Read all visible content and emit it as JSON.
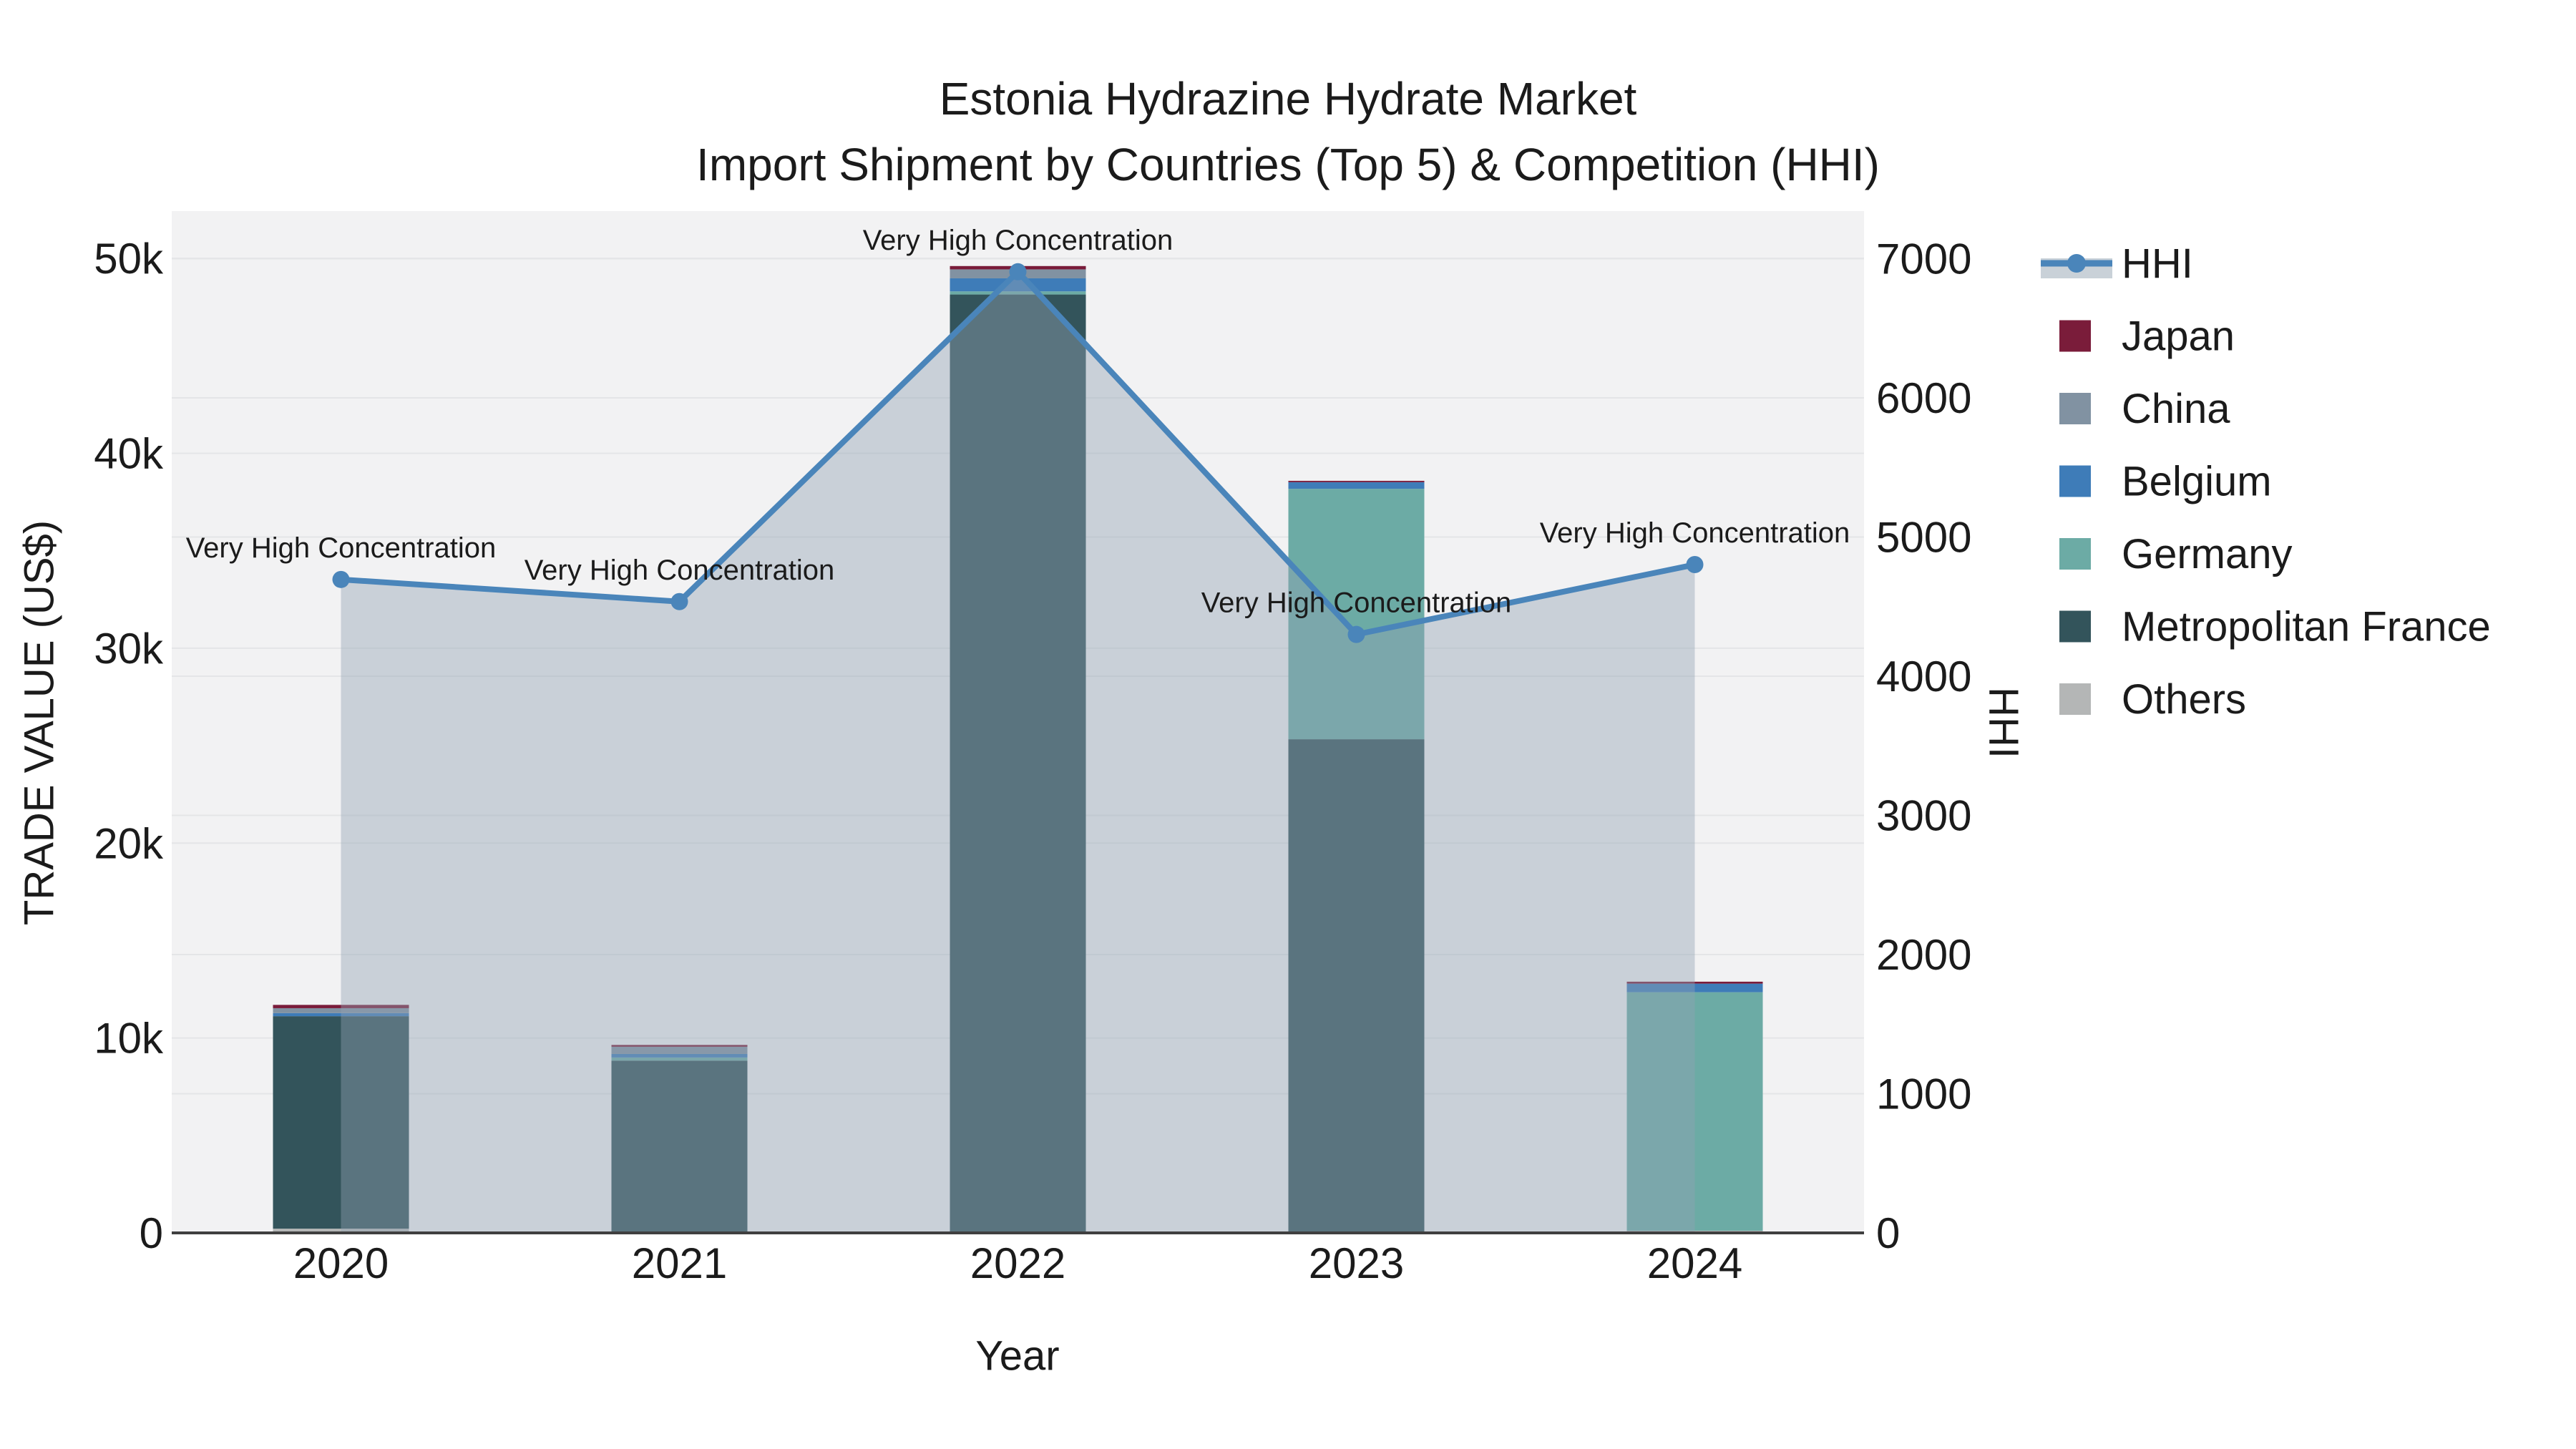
{
  "title": {
    "line1": "Estonia Hydrazine Hydrate Market",
    "line2": "Import Shipment by Countries (Top 5) & Competition (HHI)"
  },
  "axes": {
    "left": {
      "title": "TRADE VALUE (US$)",
      "ticks": [
        {
          "label": "0",
          "value": 0
        },
        {
          "label": "10k",
          "value": 10000
        },
        {
          "label": "20k",
          "value": 20000
        },
        {
          "label": "30k",
          "value": 30000
        },
        {
          "label": "40k",
          "value": 40000
        },
        {
          "label": "50k",
          "value": 50000
        }
      ]
    },
    "right": {
      "title": "HHI",
      "ticks": [
        {
          "label": "0",
          "value": 0
        },
        {
          "label": "1000",
          "value": 1000
        },
        {
          "label": "2000",
          "value": 2000
        },
        {
          "label": "3000",
          "value": 3000
        },
        {
          "label": "4000",
          "value": 4000
        },
        {
          "label": "5000",
          "value": 5000
        },
        {
          "label": "6000",
          "value": 6000
        },
        {
          "label": "7000",
          "value": 7000
        }
      ]
    },
    "x": {
      "title": "Year",
      "categories": [
        "2020",
        "2021",
        "2022",
        "2023",
        "2024"
      ]
    }
  },
  "chart_data": {
    "type": "bar+line",
    "title": "Estonia Hydrazine Hydrate Market — Import Shipment by Countries (Top 5) & Competition (HHI)",
    "categories": [
      2020,
      2021,
      2022,
      2023,
      2024
    ],
    "stack_series": [
      {
        "name": "Others",
        "color": "#b4b6b6",
        "values": [
          220,
          60,
          0,
          0,
          110
        ]
      },
      {
        "name": "Metropolitan France",
        "color": "#33545b",
        "values": [
          10900,
          8780,
          48150,
          25330,
          0
        ]
      },
      {
        "name": "Germany",
        "color": "#6caba5",
        "values": [
          0,
          160,
          160,
          12850,
          12240
        ]
      },
      {
        "name": "Belgium",
        "color": "#3e7cb8",
        "values": [
          160,
          180,
          670,
          340,
          440
        ]
      },
      {
        "name": "China",
        "color": "#8192a2",
        "values": [
          250,
          370,
          460,
          0,
          0
        ]
      },
      {
        "name": "Japan",
        "color": "#7a1c3a",
        "values": [
          170,
          95,
          170,
          70,
          100
        ]
      }
    ],
    "line_series": {
      "name": "HHI",
      "axis": "right",
      "color": "#4a85ba",
      "values": [
        4695,
        4536,
        6906,
        4300,
        4802
      ]
    },
    "ylim_left": [
      0,
      52430
    ],
    "ylim_right": [
      0,
      7342
    ],
    "xlabel": "Year",
    "ylabel_left": "TRADE VALUE (US$)",
    "ylabel_right": "HHI",
    "grid": true,
    "legend_position": "right"
  },
  "annotations": [
    {
      "year": 2020,
      "text": "Very High Concentration"
    },
    {
      "year": 2021,
      "text": "Very High Concentration"
    },
    {
      "year": 2022,
      "text": "Very High Concentration"
    },
    {
      "year": 2023,
      "text": "Very High Concentration"
    },
    {
      "year": 2024,
      "text": "Very High Concentration"
    }
  ],
  "legend": {
    "items": [
      {
        "label": "HHI",
        "type": "line"
      },
      {
        "label": "Japan",
        "type": "bar"
      },
      {
        "label": "China",
        "type": "bar"
      },
      {
        "label": "Belgium",
        "type": "bar"
      },
      {
        "label": "Germany",
        "type": "bar"
      },
      {
        "label": "Metropolitan France",
        "type": "bar"
      },
      {
        "label": "Others",
        "type": "bar"
      }
    ]
  },
  "colors": {
    "hhi_line": "#4a85ba",
    "hhi_area": "rgba(145,161,179,0.42)",
    "hhi_area_swatch": "#c9d1d8",
    "plot_bg": "#f2f2f3",
    "grid": "#e4e5e7",
    "axis_line": "#3f3f3f",
    "text": "#1b1b1b"
  }
}
